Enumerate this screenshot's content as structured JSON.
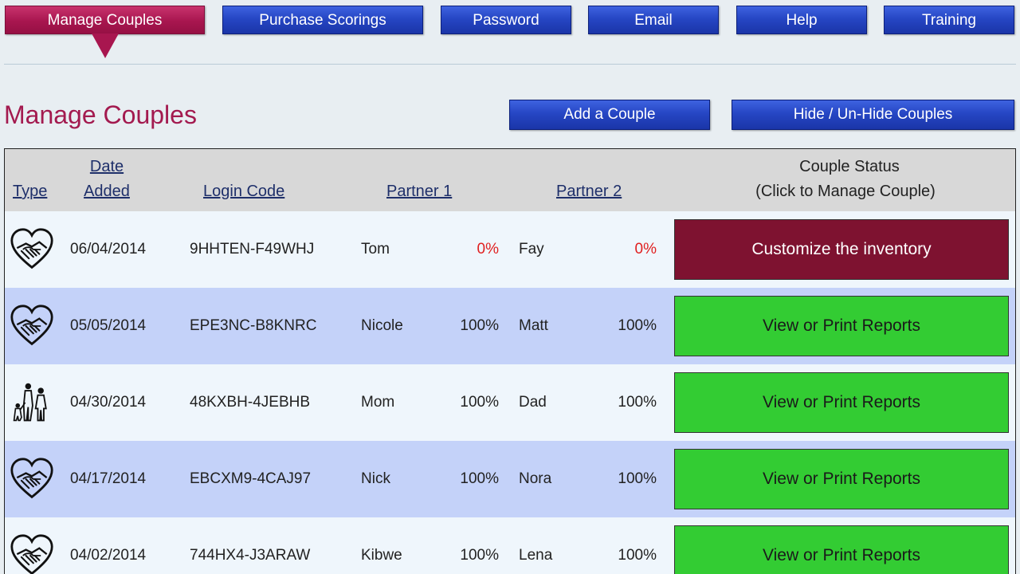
{
  "nav": {
    "tabs": [
      {
        "label": "Manage Couples",
        "active": true
      },
      {
        "label": "Purchase Scorings"
      },
      {
        "label": "Password"
      },
      {
        "label": "Email"
      },
      {
        "label": "Help"
      },
      {
        "label": "Training"
      }
    ]
  },
  "page": {
    "title": "Manage Couples",
    "add_button": "Add a Couple",
    "hide_button": "Hide / Un-Hide Couples"
  },
  "table": {
    "headers": {
      "type": "Type",
      "date_line1": "Date",
      "date_line2": "Added",
      "login_code": "Login Code",
      "partner1": "Partner 1",
      "partner2": "Partner 2",
      "status_line1": "Couple Status",
      "status_line2": "(Click to Manage Couple)"
    },
    "rows": [
      {
        "type_icon": "handshake-heart-icon",
        "date": "06/04/2014",
        "code": "9HHTEN-F49WHJ",
        "p1": "Tom",
        "p1_pct": "0%",
        "p2": "Fay",
        "p2_pct": "0%",
        "status": "Customize the inventory"
      },
      {
        "type_icon": "handshake-heart-icon",
        "date": "05/05/2014",
        "code": "EPE3NC-B8KNRC",
        "p1": "Nicole",
        "p1_pct": "100%",
        "p2": "Matt",
        "p2_pct": "100%",
        "status": "View or Print Reports"
      },
      {
        "type_icon": "family-icon",
        "date": "04/30/2014",
        "code": "48KXBH-4JEBHB",
        "p1": "Mom",
        "p1_pct": "100%",
        "p2": "Dad",
        "p2_pct": "100%",
        "status": "View or Print Reports"
      },
      {
        "type_icon": "handshake-heart-icon",
        "date": "04/17/2014",
        "code": "EBCXM9-4CAJ97",
        "p1": "Nick",
        "p1_pct": "100%",
        "p2": "Nora",
        "p2_pct": "100%",
        "status": "View or Print Reports"
      },
      {
        "type_icon": "handshake-heart-icon",
        "date": "04/02/2014",
        "code": "744HX4-J3ARAW",
        "p1": "Kibwe",
        "p1_pct": "100%",
        "p2": "Lena",
        "p2_pct": "100%",
        "status": "View or Print Reports"
      }
    ]
  },
  "colors": {
    "active_tab": "#a8164f",
    "nav_blue": "#2646c4",
    "title": "#a31a4f",
    "customize": "#7e1230",
    "reports": "#33cc33",
    "zero_pct": "#e02020"
  }
}
